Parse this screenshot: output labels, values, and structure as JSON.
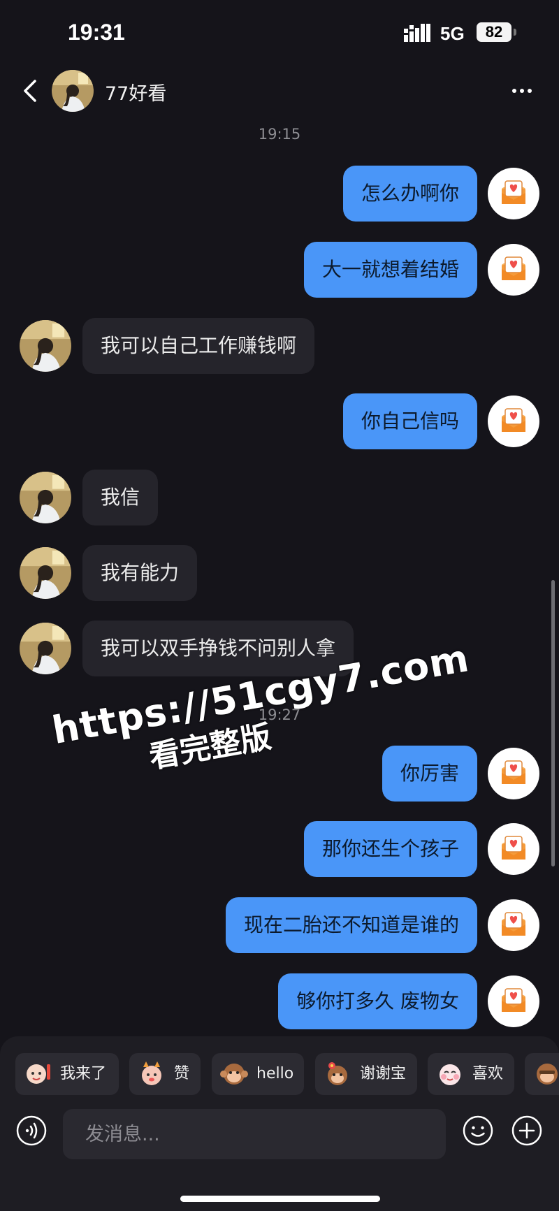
{
  "status_bar": {
    "time": "19:31",
    "network": "5G",
    "battery": "82"
  },
  "header": {
    "contact_name": "77好看"
  },
  "messages": [
    {
      "timestamp": "19:15"
    },
    {
      "text": "怎么办啊你"
    },
    {
      "text": "大一就想着结婚"
    },
    {
      "text": "我可以自己工作赚钱啊"
    },
    {
      "text": "你自己信吗"
    },
    {
      "text": "我信"
    },
    {
      "text": "我有能力"
    },
    {
      "text": "我可以双手挣钱不问别人拿"
    },
    {
      "timestamp": "19:27"
    },
    {
      "text": "你厉害"
    },
    {
      "text": "那你还生个孩子"
    },
    {
      "text": "现在二胎还不知道是谁的"
    },
    {
      "text": "够你打多久 废物女"
    }
  ],
  "watermark": {
    "line1": "https://51cgy7.com",
    "line2": "看完整版"
  },
  "quick_replies": [
    {
      "label": "我来了",
      "icon": "waving-character-icon"
    },
    {
      "label": "赞",
      "icon": "thumbs-up-character-icon"
    },
    {
      "label": "hello",
      "icon": "monkey-hello-icon"
    },
    {
      "label": "谢谢宝",
      "icon": "monkey-flower-icon"
    },
    {
      "label": "喜欢",
      "icon": "blushing-character-icon"
    }
  ],
  "input": {
    "placeholder": "发消息..."
  }
}
